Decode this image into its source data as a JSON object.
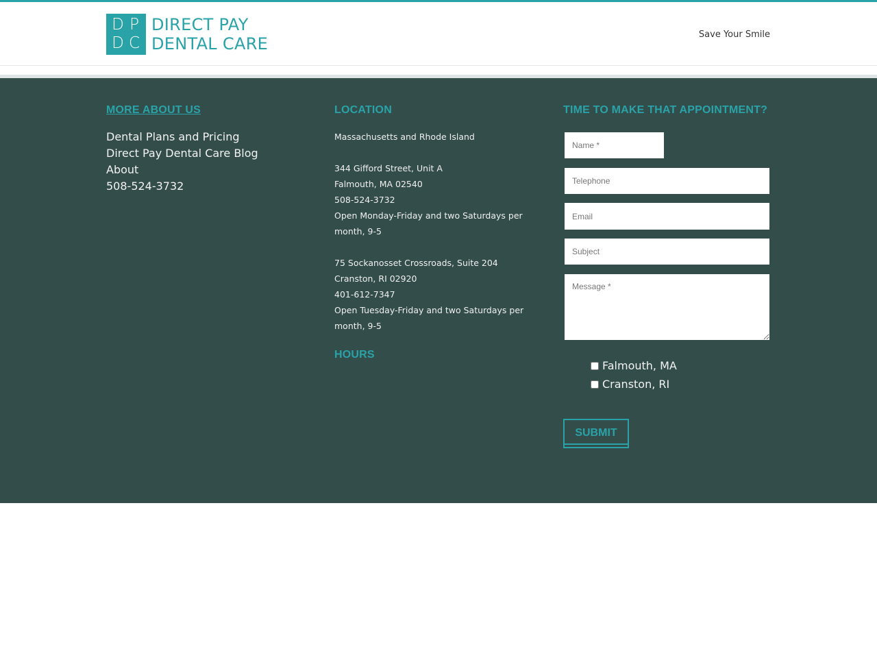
{
  "header": {
    "logo_letters": [
      "D",
      "P",
      "D",
      "C"
    ],
    "logo_line1": "DIRECT PAY",
    "logo_line2": "DENTAL CARE",
    "tagline": "Save Your Smile"
  },
  "colors": {
    "accent": "#2aa3a8",
    "footer_bg": "#334d4b",
    "footer_text": "#f2f2f2"
  },
  "about": {
    "heading": "MORE ABOUT US",
    "links": [
      "Dental Plans and Pricing",
      "Direct Pay Dental Care Blog",
      "About",
      "508-524-3732"
    ]
  },
  "location": {
    "heading": "LOCATION",
    "region": "Massachusetts and Rhode Island",
    "offices": [
      {
        "street": "344 Gifford Street, Unit A",
        "city": "Falmouth, MA 02540",
        "phone": "508-524-3732",
        "hours": "Open Monday-Friday and two Saturdays per month, 9-5"
      },
      {
        "street": "75 Sockanosset Crossroads, Suite 204",
        "city": "Cranston, RI 02920",
        "phone": "401-612-7347",
        "hours": "Open Tuesday-Friday and two Saturdays per month, 9-5"
      }
    ],
    "hours_heading": "HOURS"
  },
  "form": {
    "heading": "TIME TO MAKE THAT APPOINTMENT?",
    "fields": {
      "name": {
        "placeholder": "Name *",
        "value": ""
      },
      "telephone": {
        "placeholder": "Telephone",
        "value": ""
      },
      "email": {
        "placeholder": "Email",
        "value": ""
      },
      "subject": {
        "placeholder": "Subject",
        "value": ""
      },
      "message": {
        "placeholder": "Message *",
        "value": ""
      }
    },
    "checkboxes": [
      {
        "label": "Falmouth, MA",
        "checked": false
      },
      {
        "label": "Cranston, RI",
        "checked": false
      }
    ],
    "submit_label": "SUBMIT"
  }
}
